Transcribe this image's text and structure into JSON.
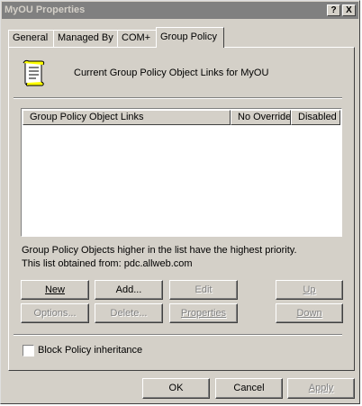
{
  "window": {
    "title": "MyOU Properties",
    "help_glyph": "?",
    "close_glyph": "X"
  },
  "tabs": [
    "General",
    "Managed By",
    "COM+",
    "Group Policy"
  ],
  "active_tab": "Group Policy",
  "header": {
    "text": "Current Group Policy Object Links for MyOU",
    "icon": "policy-scroll-icon"
  },
  "list": {
    "columns": [
      "Group Policy Object Links",
      "No Override",
      "Disabled"
    ],
    "rows": []
  },
  "notes": {
    "priority": "Group Policy Objects higher in the list have the highest priority.",
    "obtained": "This list obtained from: pdc.allweb.com"
  },
  "buttons": {
    "new": "New",
    "add": "Add...",
    "edit": "Edit",
    "up": "Up",
    "options": "Options...",
    "delete": "Delete...",
    "properties": "Properties",
    "down": "Down"
  },
  "block_inheritance": {
    "label": "Block Policy inheritance",
    "checked": false
  },
  "dialog": {
    "ok": "OK",
    "cancel": "Cancel",
    "apply": "Apply"
  }
}
